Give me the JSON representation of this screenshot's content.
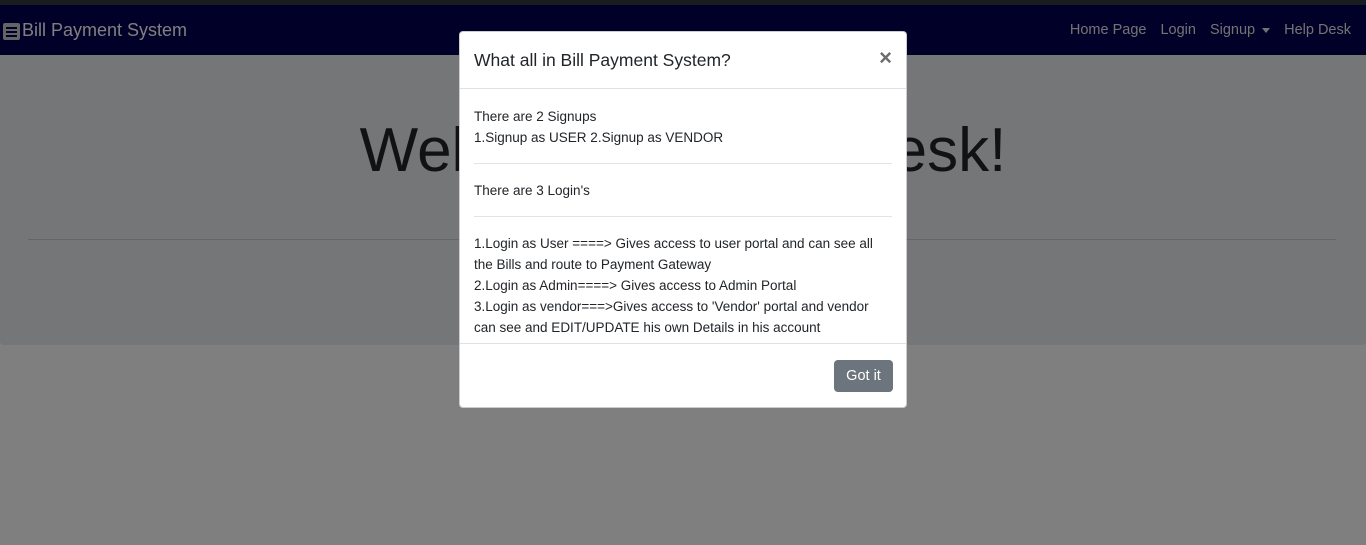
{
  "navbar": {
    "brand_icon": "menu-icon",
    "brand": "Bill Payment System",
    "links": [
      "Home Page",
      "Login",
      "Signup",
      "Help Desk"
    ],
    "background": "#000050"
  },
  "jumbotron": {
    "title": "Welcome to Help Desk!"
  },
  "modal": {
    "title": "What all in Bill Payment System?",
    "close_label": "×",
    "signups_intro": "There are 2 Signups",
    "signups_detail": "1.Signup as USER 2.Signup as VENDOR",
    "logins_intro": "There are 3 Login's",
    "login_user": "1.Login as User ====> Gives access to user portal and can see all the Bills and route to Payment Gateway",
    "login_admin": "2.Login as Admin====> Gives access to Admin Portal",
    "login_vendor": "3.Login as vendor===>Gives access to 'Vendor' portal and vendor can see and EDIT/UPDATE his own Details in his account",
    "button_label": "Got it",
    "button_color": "#6c757d"
  }
}
